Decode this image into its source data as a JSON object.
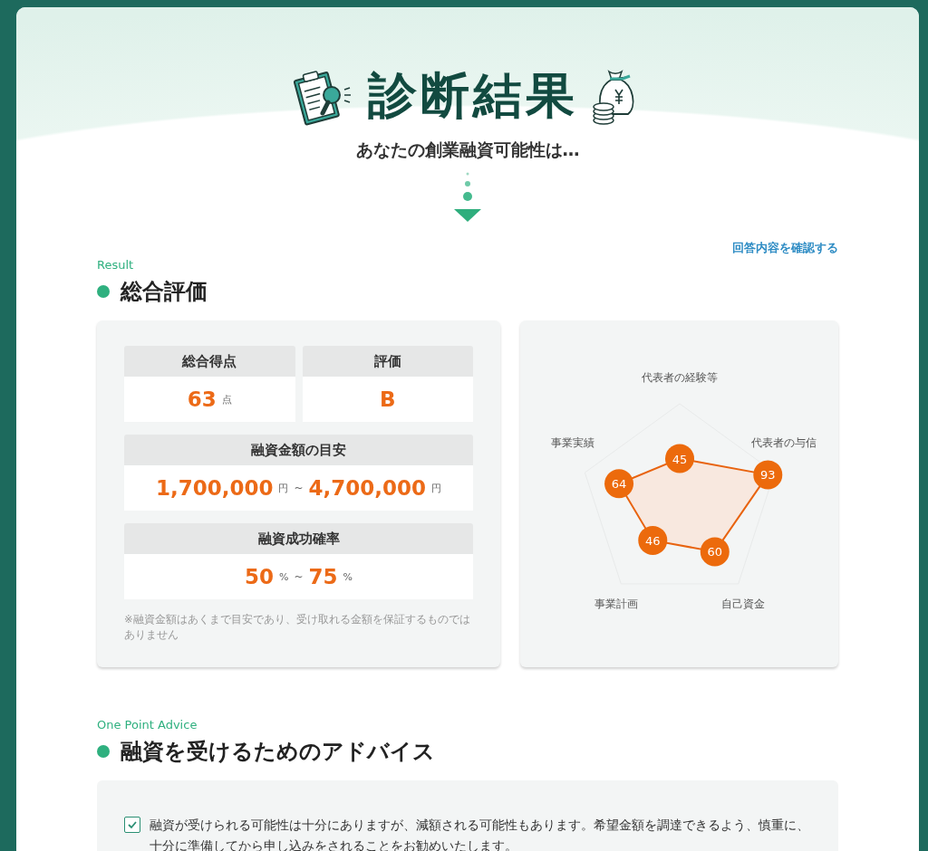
{
  "header": {
    "title": "診断結果",
    "subtitle": "あなたの創業融資可能性は…"
  },
  "answers_link": "回答内容を確認する",
  "result": {
    "eyebrow": "Result",
    "heading": "総合評価",
    "score": {
      "label": "総合得点",
      "value": "63",
      "unit": "点"
    },
    "grade": {
      "label": "評価",
      "value": "B"
    },
    "amount": {
      "label": "融資金額の目安",
      "from": "1,700,000",
      "from_unit": "円",
      "sep": "~",
      "to": "4,700,000",
      "to_unit": "円"
    },
    "rate": {
      "label": "融資成功確率",
      "from": "50",
      "from_unit": "%",
      "sep": "~",
      "to": "75",
      "to_unit": "%"
    },
    "note": "※融資金額はあくまで目安であり、受け取れる金額を保証するものではありません",
    "radar": [
      {
        "label": "代表者の経験等",
        "score": "45",
        "kind": "top"
      },
      {
        "label": "事業実績",
        "score": "64",
        "kind": "upperleft"
      },
      {
        "label": "代表者の与信",
        "score": "93",
        "kind": "upperright"
      },
      {
        "label": "事業計画",
        "score": "46",
        "kind": "lowerleft"
      },
      {
        "label": "自己資金",
        "score": "60",
        "kind": "lowerright"
      }
    ]
  },
  "advice": {
    "eyebrow": "One Point Advice",
    "heading": "融資を受けるためのアドバイス",
    "items": [
      {
        "text": "融資が受けられる可能性は十分にありますが、減額される可能性もあります。希望金額を調達できるよう、慎重に、十分に準備してから申し込みをされることをお勧めいたします。",
        "checked": true
      }
    ]
  }
}
